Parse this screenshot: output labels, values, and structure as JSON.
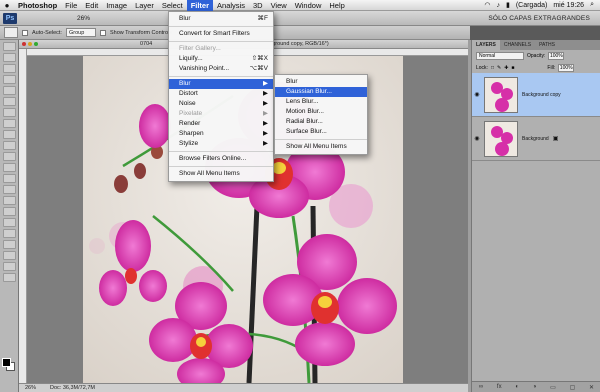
{
  "menubar": {
    "apple": "",
    "app": "Photoshop",
    "items": [
      "File",
      "Edit",
      "Image",
      "Layer",
      "Select",
      "Filter",
      "Analysis",
      "3D",
      "View",
      "Window",
      "Help"
    ],
    "active_index": 5,
    "battery": "(Cargada)",
    "clock": "mié 19:26"
  },
  "appbar": {
    "logo": "Ps",
    "zoom": "26%",
    "workspace": "SÓLO CAPAS EXTRAGRANDES"
  },
  "options": {
    "auto_select": "Auto-Select:",
    "group": "Group",
    "show_transform": "Show Transform Controls"
  },
  "document": {
    "title_left": "0704",
    "title_right": "ground copy, RGB/16*)",
    "zoom": "26%",
    "doc_size": "Doc: 36,3M/72,7M"
  },
  "layers_panel": {
    "tabs": [
      "LAYERS",
      "CHANNELS",
      "PATHS"
    ],
    "blend_mode": "Normal",
    "opacity_label": "Opacity:",
    "opacity": "100%",
    "lock_label": "Lock:",
    "fill_label": "Fill:",
    "fill": "100%",
    "layers": [
      {
        "name": "Background copy",
        "selected": true,
        "locked": false
      },
      {
        "name": "Background",
        "selected": false,
        "locked": true
      }
    ],
    "bottom_icons": [
      "link-icon",
      "fx-icon",
      "mask-icon",
      "adjustment-icon",
      "folder-icon",
      "new-layer-icon",
      "trash-icon"
    ]
  },
  "filter_menu": {
    "items": [
      {
        "label": "Blur",
        "shortcut": "⌘F",
        "disabled": false,
        "submenu": false
      },
      {
        "sep": true
      },
      {
        "label": "Convert for Smart Filters",
        "disabled": false,
        "submenu": false
      },
      {
        "sep": true
      },
      {
        "label": "Filter Gallery...",
        "disabled": true,
        "submenu": false
      },
      {
        "label": "Liquify...",
        "shortcut": "⇧⌘X",
        "disabled": false,
        "submenu": false
      },
      {
        "label": "Vanishing Point...",
        "shortcut": "⌥⌘V",
        "disabled": false,
        "submenu": false
      },
      {
        "sep": true
      },
      {
        "label": "Blur",
        "disabled": false,
        "submenu": true,
        "highlight": true
      },
      {
        "label": "Distort",
        "disabled": false,
        "submenu": true
      },
      {
        "label": "Noise",
        "disabled": false,
        "submenu": true
      },
      {
        "label": "Pixelate",
        "disabled": true,
        "submenu": true
      },
      {
        "label": "Render",
        "disabled": false,
        "submenu": true
      },
      {
        "label": "Sharpen",
        "disabled": false,
        "submenu": true
      },
      {
        "label": "Stylize",
        "disabled": false,
        "submenu": true
      },
      {
        "sep": true
      },
      {
        "label": "Browse Filters Online...",
        "disabled": false,
        "submenu": false
      },
      {
        "sep": true
      },
      {
        "label": "Show All Menu Items",
        "disabled": false,
        "submenu": false
      }
    ]
  },
  "blur_menu": {
    "items": [
      {
        "label": "Blur"
      },
      {
        "label": "Gaussian Blur...",
        "highlight": true
      },
      {
        "label": "Lens Blur..."
      },
      {
        "label": "Motion Blur..."
      },
      {
        "label": "Radial Blur..."
      },
      {
        "label": "Surface Blur..."
      },
      {
        "sep": true
      },
      {
        "label": "Show All Menu Items"
      }
    ]
  },
  "colors": {
    "menu_highlight": "#2f62d8",
    "orchid": "#d62fa8",
    "stem": "#3f9a3a"
  }
}
